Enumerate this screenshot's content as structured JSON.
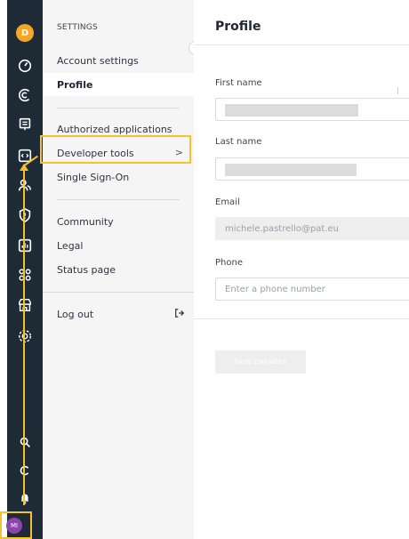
{
  "rail": {
    "user_initial": "D",
    "user_initials_bottom": "MI",
    "top_icons": [
      "dashboard-icon",
      "swirl-icon",
      "screen-icon",
      "code-icon",
      "users-icon",
      "shield-icon",
      "chart-icon",
      "nodes-icon",
      "storefront-icon",
      "gear-icon"
    ],
    "bottom_icons": [
      "search-icon",
      "refresh-icon",
      "bell-icon"
    ],
    "accent_top": "#f5a623",
    "accent_bottom": "#8e44ad"
  },
  "menu": {
    "heading": "SETTINGS",
    "items": [
      {
        "label": "Account settings"
      },
      {
        "label": "Profile"
      },
      {
        "label": "Authorized applications"
      },
      {
        "label": "Developer tools",
        "chevron": ">"
      },
      {
        "label": "Single Sign-On"
      },
      {
        "label": "Community"
      },
      {
        "label": "Legal"
      },
      {
        "label": "Status page"
      },
      {
        "label": "Log out"
      }
    ],
    "active_index": 1,
    "collapse_glyph": "‹"
  },
  "content": {
    "title": "Profile",
    "fields": [
      {
        "label": "First name",
        "value": "",
        "placeholder": ""
      },
      {
        "label": "Last name",
        "value": "",
        "placeholder": ""
      },
      {
        "label": "Email",
        "value": "michele.pastrello@pat.eu",
        "placeholder": ""
      },
      {
        "label": "Phone",
        "value": "",
        "placeholder": "Enter a phone number"
      }
    ],
    "save_label": "SAVE CHANGES"
  },
  "annotation_color": "#f6c22c"
}
